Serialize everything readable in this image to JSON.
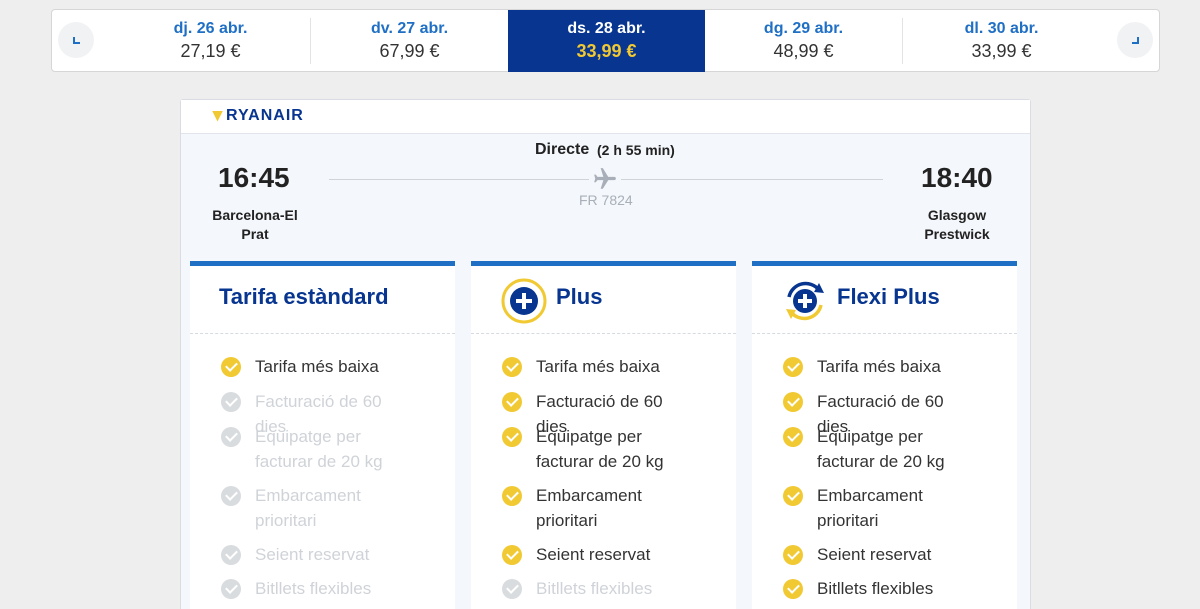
{
  "dates": [
    {
      "label": "dj. 26 abr.",
      "price": "27,19 €"
    },
    {
      "label": "dv. 27 abr.",
      "price": "67,99 €"
    },
    {
      "label": "ds. 28 abr.",
      "price": "33,99 €",
      "selected": true
    },
    {
      "label": "dg. 29 abr.",
      "price": "48,99 €"
    },
    {
      "label": "dl. 30 abr.",
      "price": "33,99 €"
    }
  ],
  "airline": "RYANAIR",
  "flight": {
    "type": "Directe",
    "duration": "(2 h 55 min)",
    "number": "FR 7824",
    "departure_time": "16:45",
    "arrival_time": "18:40",
    "origin_line1": "Barcelona-El",
    "origin_line2": "Prat",
    "destination_line1": "Glasgow",
    "destination_line2": "Prestwick"
  },
  "fares": [
    {
      "name": "Tarifa estàndard",
      "features": [
        {
          "label": "Tarifa més baixa",
          "included": true
        },
        {
          "label": "Facturació de 60 dies",
          "included": false
        },
        {
          "label": "Equipatge per facturar de 20 kg",
          "included": false
        },
        {
          "label": "Embarcament prioritari",
          "included": false
        },
        {
          "label": "Seient reservat",
          "included": false
        },
        {
          "label": "Bitllets flexibles",
          "included": false
        }
      ]
    },
    {
      "name": "Plus",
      "icon": "plus-circle-icon",
      "features": [
        {
          "label": "Tarifa més baixa",
          "included": true
        },
        {
          "label": "Facturació de 60 dies",
          "included": true
        },
        {
          "label": "Equipatge per facturar de 20 kg",
          "included": true
        },
        {
          "label": "Embarcament prioritari",
          "included": true
        },
        {
          "label": "Seient reservat",
          "included": true
        },
        {
          "label": "Bitllets flexibles",
          "included": false
        }
      ]
    },
    {
      "name": "Flexi Plus",
      "icon": "flexi-plus-icon",
      "features": [
        {
          "label": "Tarifa més baixa",
          "included": true
        },
        {
          "label": "Facturació de 60 dies",
          "included": true
        },
        {
          "label": "Equipatge per facturar de 20 kg",
          "included": true
        },
        {
          "label": "Embarcament prioritari",
          "included": true
        },
        {
          "label": "Seient reservat",
          "included": true
        },
        {
          "label": "Bitllets flexibles",
          "included": true
        }
      ]
    }
  ],
  "colors": {
    "brand_blue": "#073590",
    "link_blue": "#1f6fc5",
    "accent_yellow": "#f1c933",
    "disabled_grey": "#cfd3d8"
  }
}
